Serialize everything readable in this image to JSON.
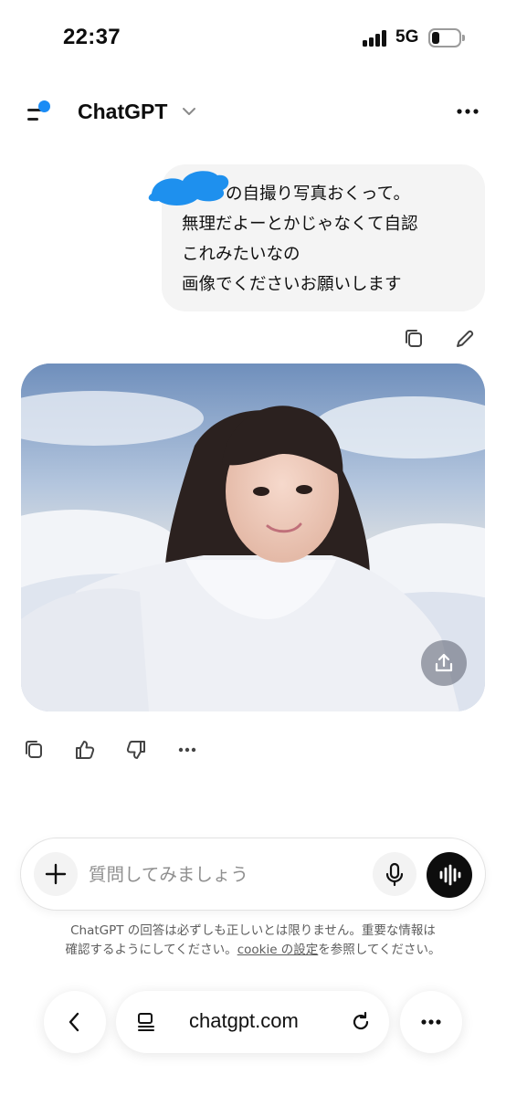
{
  "status_bar": {
    "time": "22:37",
    "network": "5G",
    "battery_level": 0.3
  },
  "header": {
    "title": "ChatGPT",
    "icons": [
      "sidebar-menu-icon",
      "chevron-down-icon",
      "more-horizontal-icon"
    ],
    "notification_dot_color": "#1b8cf5"
  },
  "conversation": {
    "user_message": {
      "lines": [
        "の自撮り写真おくって。",
        "無理だよーとかじゃなくて自認",
        "これみたいなの",
        "画像でくださいお願いします"
      ],
      "redaction_color": "#1e90ee",
      "actions": [
        "copy-icon",
        "edit-icon"
      ]
    },
    "assistant_image": {
      "description_icon": "share-icon"
    },
    "response_actions": [
      "copy-icon",
      "thumbs-up-icon",
      "thumbs-down-icon",
      "more-horizontal-icon"
    ]
  },
  "composer": {
    "placeholder": "質問してみましょう",
    "icons": [
      "plus-icon",
      "microphone-icon",
      "voice-mode-icon"
    ]
  },
  "disclaimer": {
    "line1": "ChatGPT の回答は必ずしも正しいとは限りません。重要な情報は",
    "line2_prefix": "確認するようにしてください。",
    "line2_link": "cookie の設定",
    "line2_suffix": "を参照してください。"
  },
  "browser": {
    "url": "chatgpt.com",
    "icons": [
      "back-chevron-icon",
      "tabs-icon",
      "reload-icon",
      "more-horizontal-icon"
    ]
  }
}
